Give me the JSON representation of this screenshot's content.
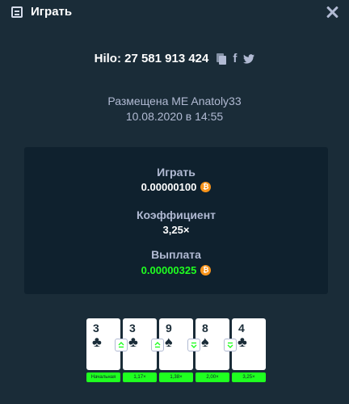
{
  "header": {
    "title": "Играть"
  },
  "bet": {
    "id_text": "Hilo: 27 581 913 424"
  },
  "placed": {
    "by_text": "Размещена ME Anatoly33",
    "date_text": "10.08.2020 в 14:55"
  },
  "stats": {
    "bet_label": "Играть",
    "bet_amount": "0.00000100",
    "multiplier_label": "Коэффициент",
    "multiplier_value": "3,25×",
    "payout_label": "Выплата",
    "payout_amount": "0.00000325",
    "currency_icon": "bitcoin-icon",
    "currency_symbol": "₿"
  },
  "cards": [
    {
      "rank": "3",
      "suit": "♣",
      "suit_name": "clubs",
      "tag": "Начальная",
      "guess": ""
    },
    {
      "rank": "3",
      "suit": "♣",
      "suit_name": "clubs",
      "tag": "1,17×",
      "guess": "higher-or-equal"
    },
    {
      "rank": "9",
      "suit": "♠",
      "suit_name": "spades",
      "tag": "1,38×",
      "guess": "higher-or-equal"
    },
    {
      "rank": "8",
      "suit": "♠",
      "suit_name": "spades",
      "tag": "2,00×",
      "guess": "lower-or-equal"
    },
    {
      "rank": "4",
      "suit": "♣",
      "suit_name": "clubs",
      "tag": "3,25×",
      "guess": "lower-or-equal"
    }
  ],
  "colors": {
    "background": "#1a2c38",
    "panel": "#0f212e",
    "accent_green": "#1fff20",
    "muted_text": "#b1bad3",
    "bitcoin": "#f7931a"
  }
}
